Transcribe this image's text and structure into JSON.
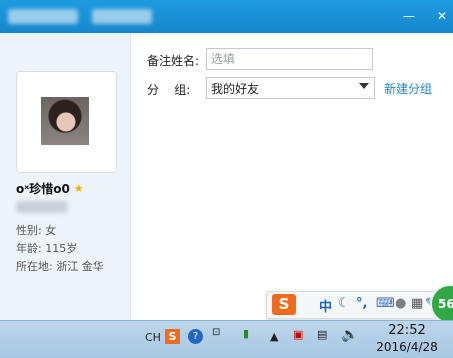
{
  "window": {
    "minimize_label": "—",
    "close_label": "✕"
  },
  "profile": {
    "nickname": "oˣ珍惜o0",
    "gender_label": "性别:",
    "gender": "女",
    "age_label": "年龄:",
    "age": "115岁",
    "location_label": "所在地:",
    "location": "浙江 金华"
  },
  "form": {
    "remark_label": "备注姓名:",
    "remark_placeholder": "选填",
    "group_label": "分    组:",
    "group_value": "我的好友",
    "new_group_link": "新建分组"
  },
  "ime_toolbar": {
    "logo": "S",
    "mode": "中",
    "punct": "°,",
    "badge": "56"
  },
  "taskbar": {
    "lang": "CH",
    "time": "22:52",
    "date": "2016/4/28"
  },
  "colors": {
    "titlebar": "#1686cc",
    "link": "#1f86c8",
    "ime_logo": "#f26b1d",
    "badge": "#2fa845"
  }
}
